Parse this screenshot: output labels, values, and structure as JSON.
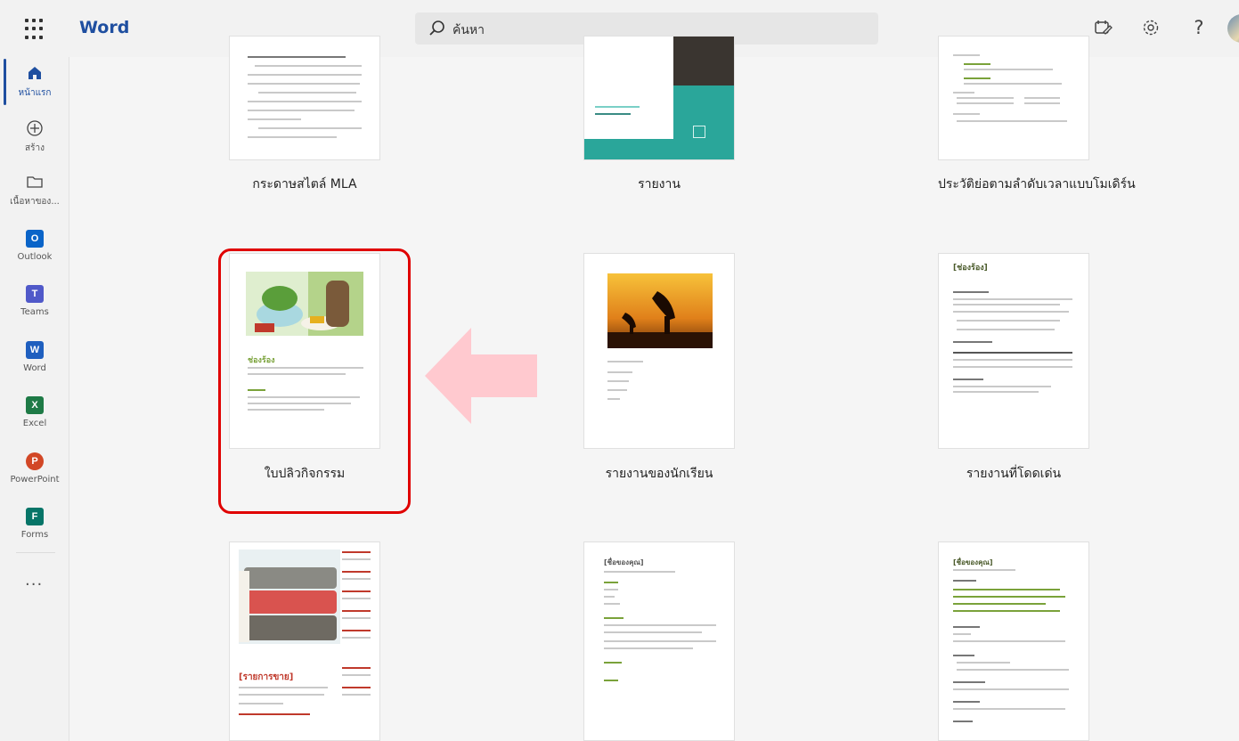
{
  "app": {
    "name": "Word"
  },
  "search": {
    "placeholder": "ค้นหา"
  },
  "rail": {
    "items": [
      {
        "label": "หน้าแรก"
      },
      {
        "label": "สร้าง"
      },
      {
        "label": "เนื้อหาของ..."
      },
      {
        "label": "Outlook"
      },
      {
        "label": "Teams"
      },
      {
        "label": "Word"
      },
      {
        "label": "Excel"
      },
      {
        "label": "PowerPoint"
      },
      {
        "label": "Forms"
      }
    ],
    "more": "···"
  },
  "templates": [
    {
      "label": "กระดาษสไตล์ MLA"
    },
    {
      "label": "รายงาน"
    },
    {
      "label": "ประวัติย่อตามลำดับเวลาแบบโมเดิร์น"
    },
    {
      "label": "ใบปลิวกิจกรรม",
      "highlighted": true
    },
    {
      "label": "รายงานของนักเรียน"
    },
    {
      "label": "รายงานที่โดดเด่น"
    },
    {
      "label": ""
    },
    {
      "label": ""
    },
    {
      "label": ""
    }
  ],
  "thumb_text": {
    "flyer_title": "ช่องร้อง",
    "standout_title": "[ช่องร้อง]",
    "sale_title": "[รายการขาย]",
    "cv1_title": "[ชื่อของคุณ]",
    "cv2_title": "[ชื่อของคุณ]"
  },
  "colors": {
    "accent": "#1f4fa0",
    "highlight": "#e00000",
    "arrow": "#ffc9cf"
  }
}
